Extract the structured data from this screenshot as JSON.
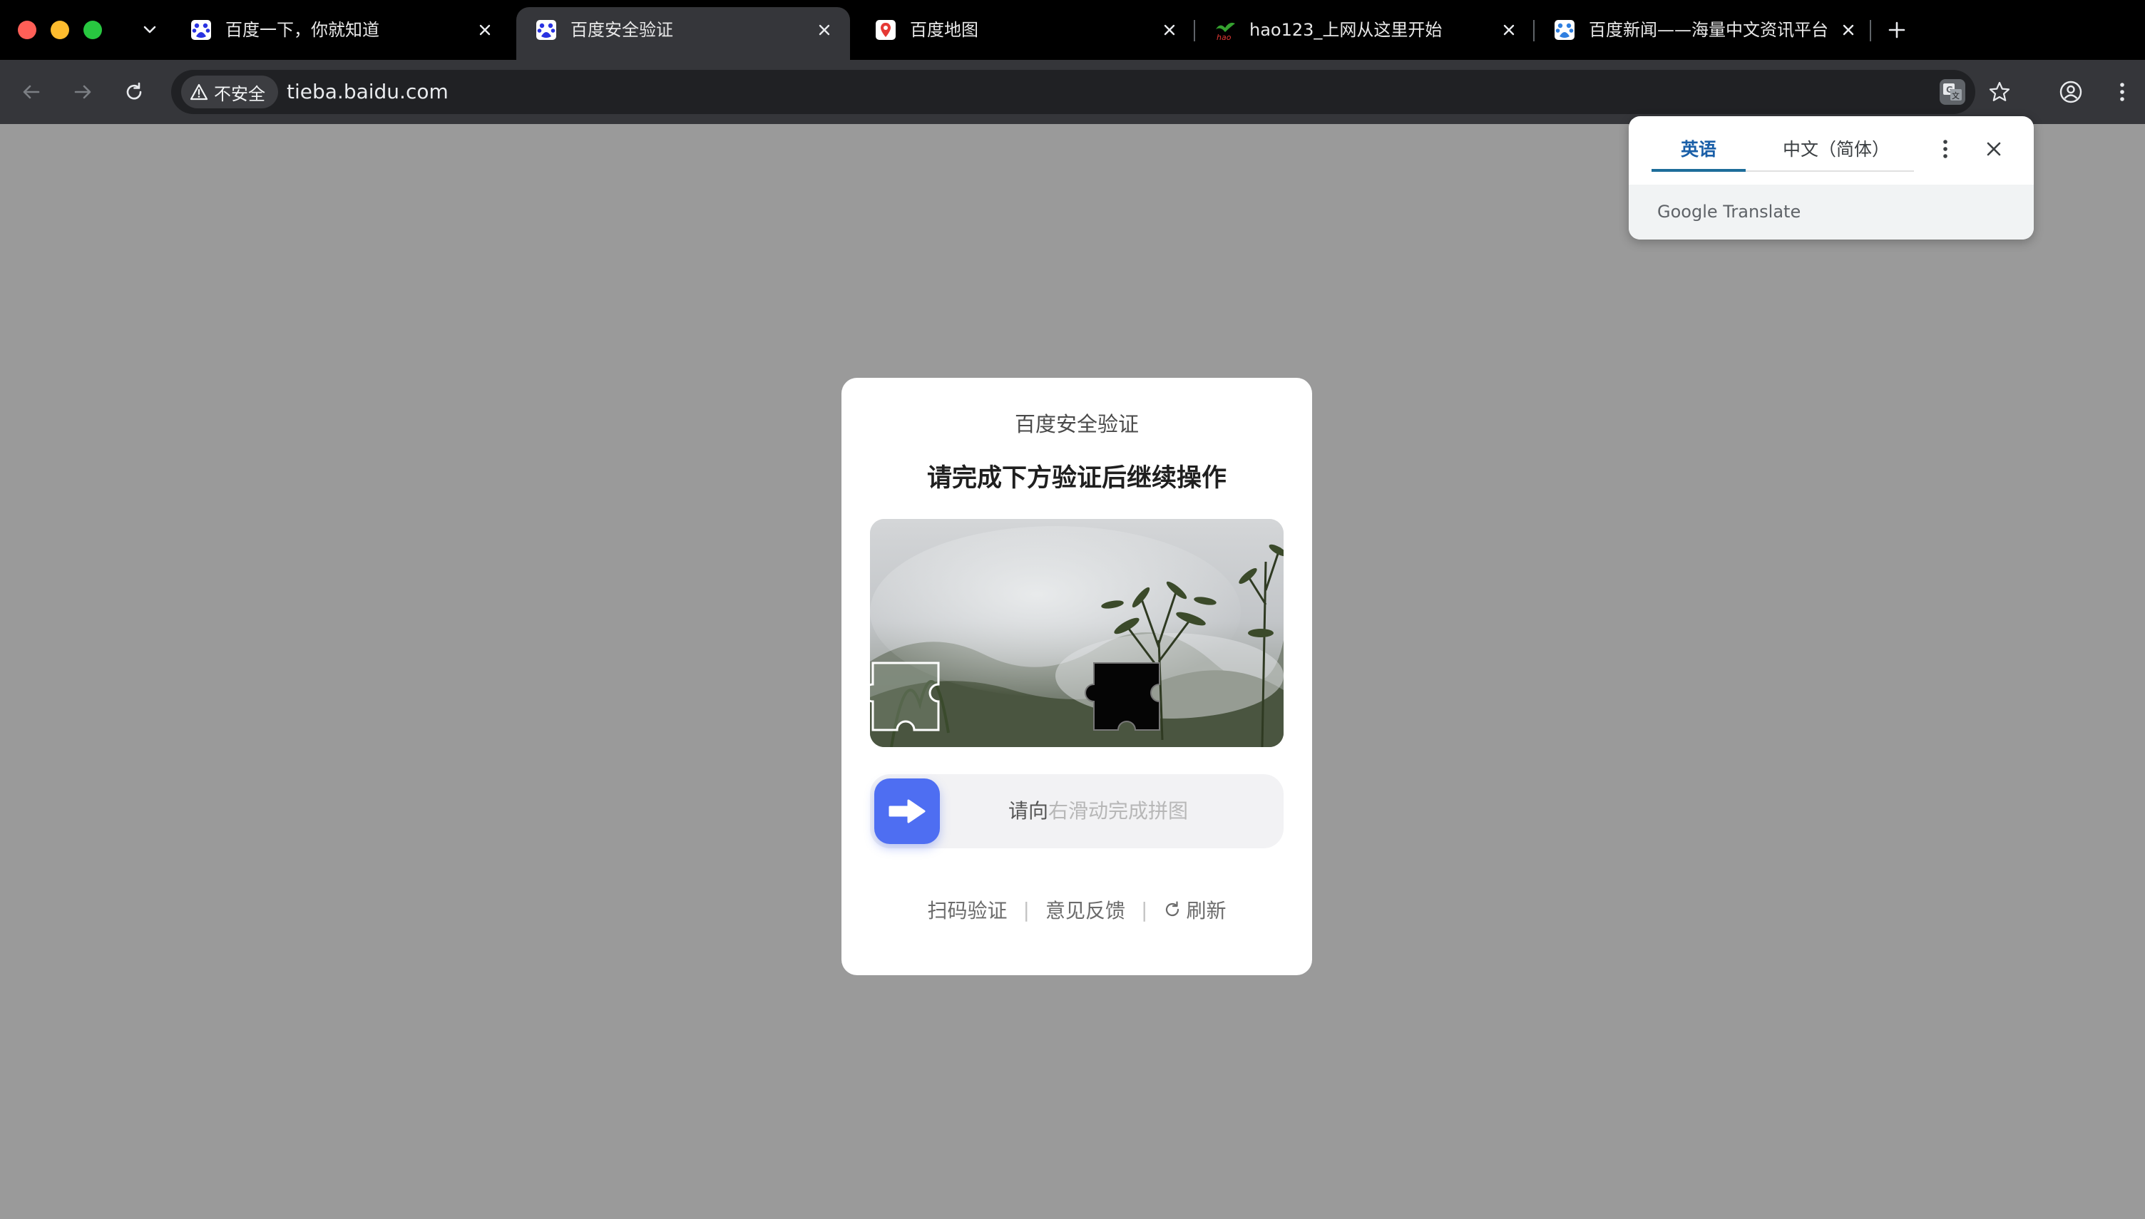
{
  "browser": {
    "tabs": [
      {
        "title": "百度一下，你就知道",
        "favicon": "baidu-paw-icon",
        "active": false
      },
      {
        "title": "百度安全验证",
        "favicon": "baidu-paw-icon",
        "active": true
      },
      {
        "title": "百度地图",
        "favicon": "map-pin-icon",
        "active": false
      },
      {
        "title": "hao123_上网从这里开始",
        "favicon": "hao123-icon",
        "active": false
      },
      {
        "title": "百度新闻——海量中文资讯平台",
        "favicon": "baidu-paw-icon",
        "active": false
      }
    ],
    "security_label": "不安全",
    "url": "tieba.baidu.com"
  },
  "translate": {
    "source_lang": "英语",
    "target_lang": "中文（简体）",
    "brand": "Google Translate"
  },
  "verify": {
    "title": "百度安全验证",
    "subtitle": "请完成下方验证后继续操作",
    "slider_hint_dark": "请向",
    "slider_hint_light": "右滑动完成拼图",
    "link_scan": "扫码验证",
    "link_feedback": "意见反馈",
    "link_refresh": "刷新",
    "divider": "|"
  },
  "colors": {
    "accent": "#4e6ef2",
    "page_background": "#9a9a9a",
    "tab_strip": "#000000",
    "toolbar": "#35363a"
  }
}
